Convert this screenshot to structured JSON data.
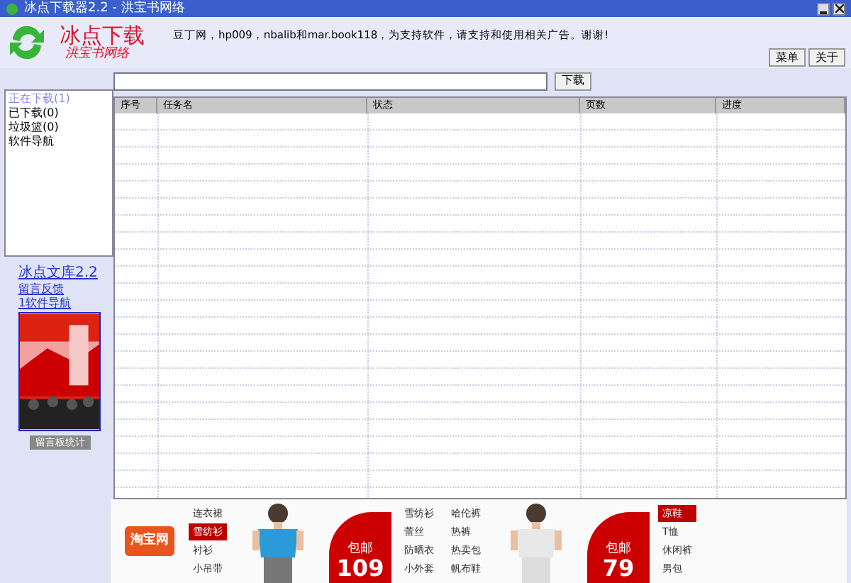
{
  "window": {
    "title": "冰点下载器2.2 - 洪宝书网络"
  },
  "header": {
    "logo_title": "冰点下载",
    "logo_subtitle": "洪宝书网络",
    "notice": "豆丁网，hp009，nbalib和mar.book118，为支持软件，请支持和使用相关广告。谢谢!",
    "buttons": [
      "菜单",
      "关于"
    ]
  },
  "url_bar": {
    "button": "下载"
  },
  "sidebar": {
    "items": [
      {
        "label": "正在下载(1)",
        "selected": true
      },
      {
        "label": "已下载(0)",
        "selected": false
      },
      {
        "label": "垃圾篮(0)",
        "selected": false
      },
      {
        "label": "软件导航",
        "selected": false
      }
    ],
    "promo_title": "冰点文库2.2",
    "links": [
      "留言反馈",
      "1软件导航"
    ],
    "promo_button": "留言板统计"
  },
  "table": {
    "columns": [
      "序号",
      "任务名",
      "状态",
      "页数",
      "进度"
    ]
  },
  "ads": [
    {
      "kind": "logo",
      "label": "淘宝网"
    },
    {
      "kind": "links",
      "items": [
        {
          "label": "连衣裙",
          "selected": false
        },
        {
          "label": "雪纺衫",
          "selected": true
        },
        {
          "label": "衬衫",
          "selected": false
        },
        {
          "label": "小吊带",
          "selected": false
        }
      ]
    },
    {
      "kind": "picture"
    },
    {
      "kind": "price",
      "label": "包邮",
      "price": "109"
    },
    {
      "kind": "links",
      "items": [
        {
          "label": "雪纺衫",
          "selected": false
        },
        {
          "label": "蕾丝",
          "selected": false
        },
        {
          "label": "防晒衣",
          "selected": false
        },
        {
          "label": "小外套",
          "selected": false
        }
      ]
    },
    {
      "kind": "links",
      "items": [
        {
          "label": "哈伦裤",
          "selected": false
        },
        {
          "label": "热裤",
          "selected": false
        },
        {
          "label": "热卖包",
          "selected": false
        },
        {
          "label": "帆布鞋",
          "selected": false
        }
      ]
    },
    {
      "kind": "picture"
    },
    {
      "kind": "price",
      "label": "包邮",
      "price": "79"
    },
    {
      "kind": "links",
      "items": [
        {
          "label": "凉鞋",
          "selected": true
        },
        {
          "label": "T恤",
          "selected": false
        },
        {
          "label": "休闲裤",
          "selected": false
        },
        {
          "label": "男包",
          "selected": false
        }
      ]
    }
  ]
}
